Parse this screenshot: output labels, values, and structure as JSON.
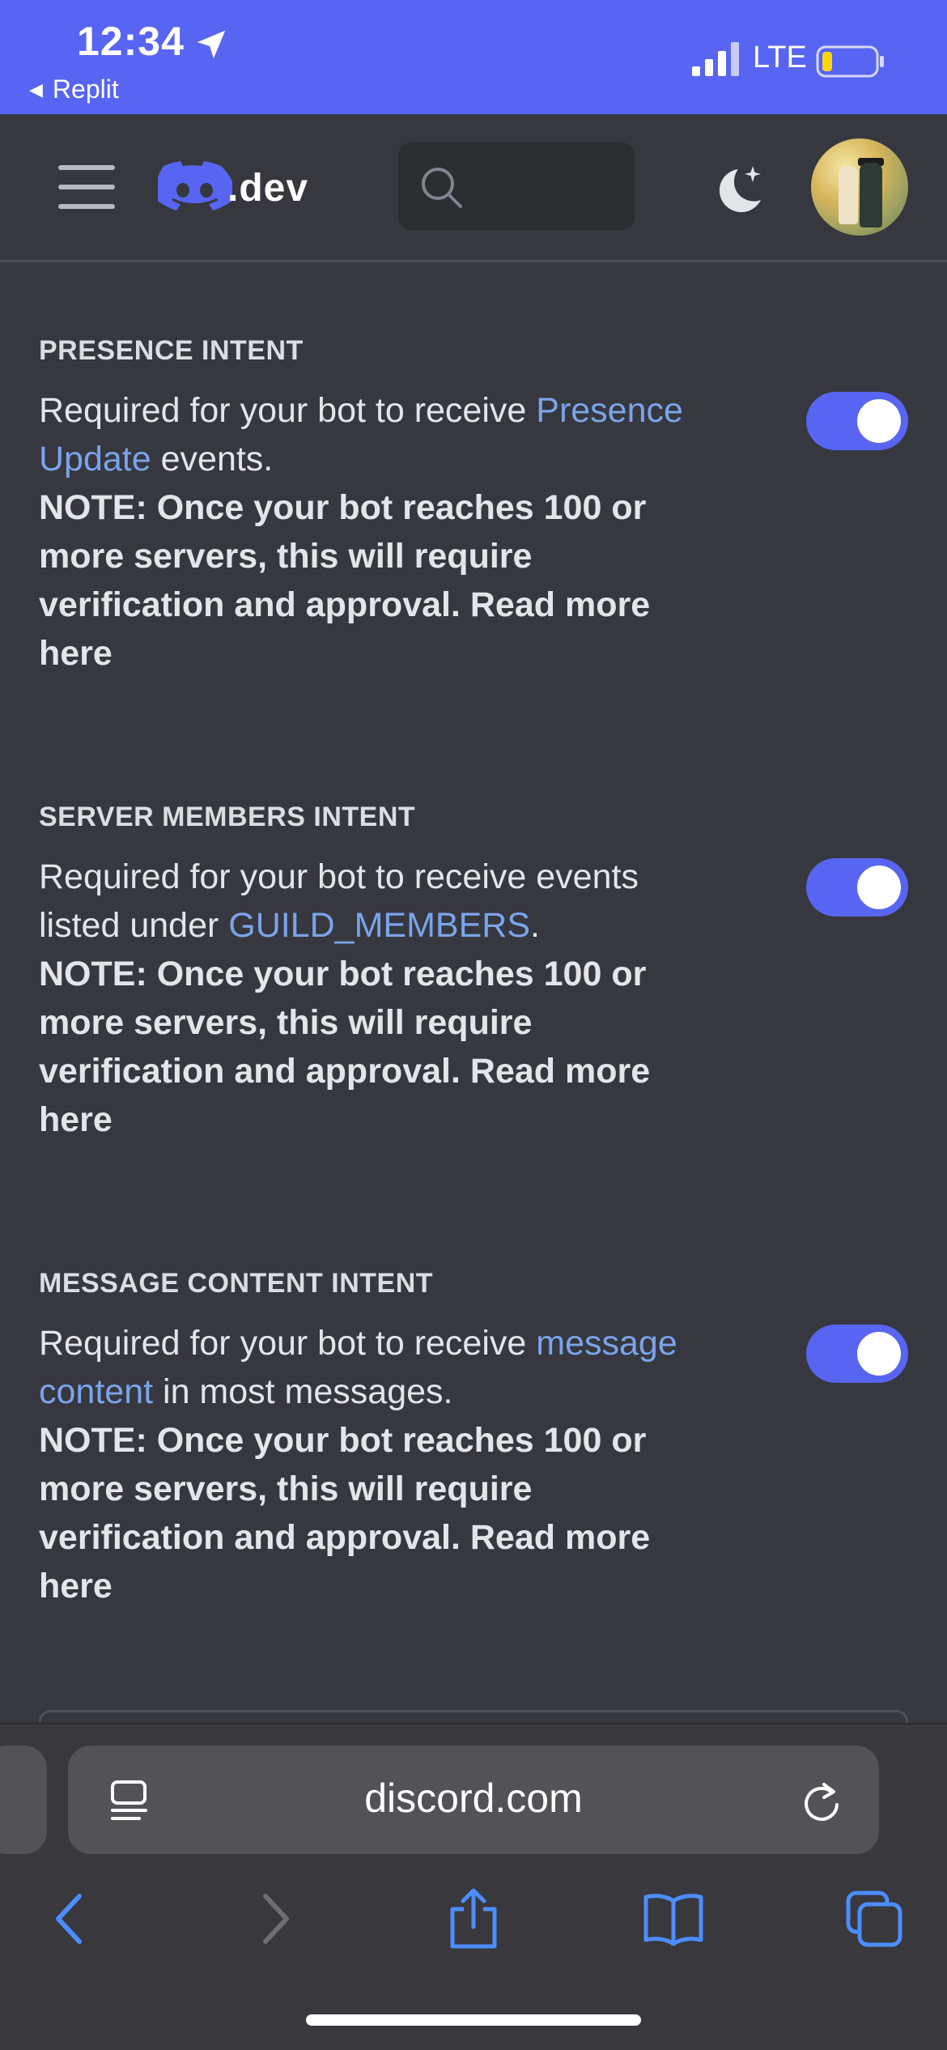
{
  "status_bar": {
    "time": "12:34",
    "back_app": "Replit",
    "network": "LTE",
    "battery_level": 0.2
  },
  "header": {
    "logo_text": ".dev",
    "search_icon": "search-icon",
    "theme_icon": "moon-sparkle-icon"
  },
  "intents": [
    {
      "title": "PRESENCE INTENT",
      "desc_pre": "Required for your bot to receive ",
      "desc_link": "Presence Update",
      "desc_post": " events.",
      "note": "NOTE: Once your bot reaches 100 or more servers, this will require verification and approval. ",
      "note_link": "Read more here",
      "enabled": true
    },
    {
      "title": "SERVER MEMBERS INTENT",
      "desc_pre": "Required for your bot to receive events listed under ",
      "desc_link": "GUILD_MEMBERS",
      "desc_post": ".",
      "note": "NOTE: Once your bot reaches 100 or more servers, this will require verification and approval. ",
      "note_link": "Read more here",
      "enabled": true
    },
    {
      "title": "MESSAGE CONTENT INTENT",
      "desc_pre": "Required for your bot to receive ",
      "desc_link": "message content",
      "desc_post": " in most messages.",
      "note": "NOTE: Once your bot reaches 100 or more servers, this will require verification and approval. ",
      "note_link": "Read more here",
      "enabled": true
    }
  ],
  "browser": {
    "url": "discord.com"
  },
  "colors": {
    "accent": "#5865f2",
    "link": "#7aa4ea",
    "background": "#36373f"
  }
}
